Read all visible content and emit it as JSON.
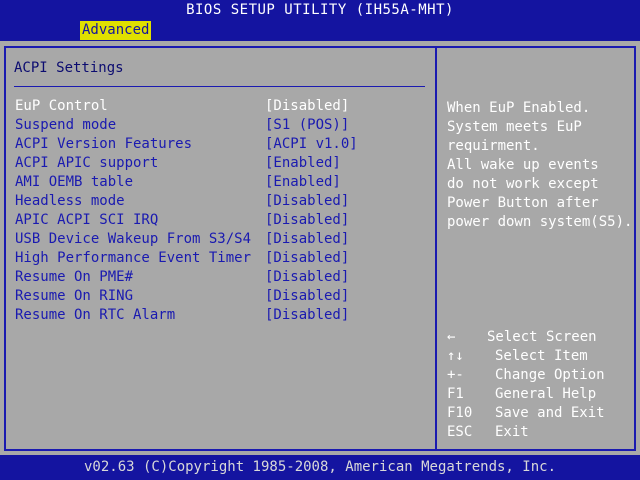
{
  "title": "BIOS SETUP UTILITY (IH55A-MHT)",
  "tab": "Advanced",
  "section_title": "ACPI Settings",
  "settings": [
    {
      "label": "EuP Control",
      "value": "[Disabled]",
      "selected": true
    },
    {
      "label": "Suspend mode",
      "value": "[S1 (POS)]"
    },
    {
      "label": "ACPI Version Features",
      "value": "[ACPI v1.0]"
    },
    {
      "label": "ACPI APIC support",
      "value": "[Enabled]"
    },
    {
      "label": "AMI OEMB table",
      "value": "[Enabled]"
    },
    {
      "label": "Headless mode",
      "value": "[Disabled]"
    },
    {
      "label": "APIC ACPI SCI IRQ",
      "value": "[Disabled]"
    },
    {
      "label": "USB Device Wakeup From S3/S4",
      "value": "[Disabled]"
    },
    {
      "label": "High Performance Event Timer",
      "value": "[Disabled]"
    },
    {
      "label": "Resume On PME#",
      "value": "[Disabled]"
    },
    {
      "label": "Resume On RING",
      "value": "[Disabled]"
    },
    {
      "label": "Resume On RTC Alarm",
      "value": "[Disabled]"
    }
  ],
  "help_text": "When EuP Enabled.\nSystem meets EuP\nrequirment.\nAll wake up events\ndo not work except\nPower Button after\npower down system(S5).",
  "keys": [
    {
      "key": "←",
      "desc": "Select Screen"
    },
    {
      "key": "↑↓",
      "desc": "Select Item"
    },
    {
      "key": "+-",
      "desc": "Change Option"
    },
    {
      "key": "F1",
      "desc": "General Help"
    },
    {
      "key": "F10",
      "desc": "Save and Exit"
    },
    {
      "key": "ESC",
      "desc": "Exit"
    }
  ],
  "footer": "v02.63 (C)Copyright 1985-2008, American Megatrends, Inc.",
  "colors": {
    "background": "#1414a0",
    "panel": "#a8a8a8",
    "tab_highlight": "#e0e000",
    "text_blue": "#1a1ab0",
    "text_white": "#ffffff"
  }
}
